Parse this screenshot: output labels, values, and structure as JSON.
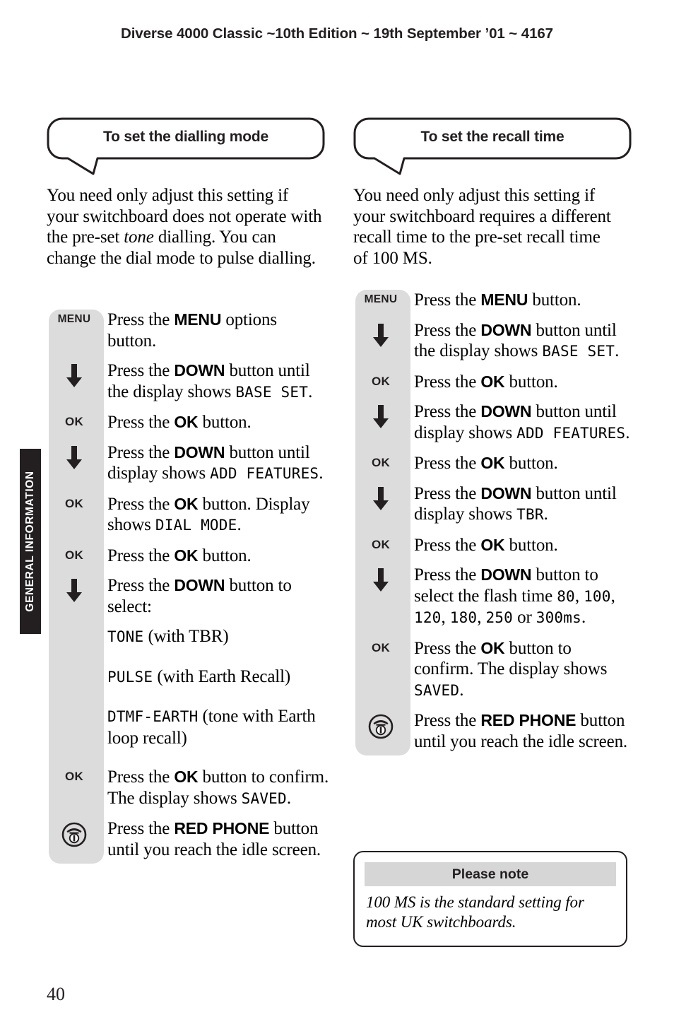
{
  "page": {
    "running_header": "Diverse 4000 Classic ~10th Edition ~ 19th September ’01 ~ 4167",
    "folio": "40",
    "side_tab_label": "GENERAL INFORMATION",
    "colors": {
      "text": "#231f20",
      "rail_grey": "#dcdcdc",
      "note_header_grey": "#d6d6d6",
      "tab_black": "#231f20",
      "page_white": "#ffffff"
    }
  },
  "left_column": {
    "heading": "To set the dialling mode",
    "intro": {
      "part1": "You need only adjust this setting if your switchboard does not operate with the pre-set ",
      "emphasis": "tone",
      "part2": " dialling. You can change the dial mode to pulse dialling."
    },
    "steps": [
      {
        "icon": "menu-button-icon",
        "icon_label": "MENU",
        "text_runs": [
          {
            "style": "normal",
            "text": "Press the "
          },
          {
            "style": "bold",
            "text": "MENU"
          },
          {
            "style": "normal",
            "text": " options button."
          }
        ]
      },
      {
        "icon": "down-arrow-icon",
        "icon_label": "",
        "text_runs": [
          {
            "style": "normal",
            "text": "Press the "
          },
          {
            "style": "bold",
            "text": "DOWN"
          },
          {
            "style": "normal",
            "text": " button until the display shows "
          },
          {
            "style": "lcd",
            "text": "BASE SET"
          },
          {
            "style": "normal",
            "text": "."
          }
        ]
      },
      {
        "icon": "ok-button-icon",
        "icon_label": "OK",
        "text_runs": [
          {
            "style": "normal",
            "text": "Press the "
          },
          {
            "style": "bold",
            "text": "OK"
          },
          {
            "style": "normal",
            "text": " button."
          }
        ]
      },
      {
        "icon": "down-arrow-icon",
        "icon_label": "",
        "text_runs": [
          {
            "style": "normal",
            "text": "Press the "
          },
          {
            "style": "bold",
            "text": "DOWN"
          },
          {
            "style": "normal",
            "text": " button until display shows "
          },
          {
            "style": "lcd",
            "text": "ADD FEATURES"
          },
          {
            "style": "normal",
            "text": "."
          }
        ]
      },
      {
        "icon": "ok-button-icon",
        "icon_label": "OK",
        "text_runs": [
          {
            "style": "normal",
            "text": "Press the "
          },
          {
            "style": "bold",
            "text": "OK"
          },
          {
            "style": "normal",
            "text": " button. Display shows "
          },
          {
            "style": "lcd",
            "text": "DIAL MODE"
          },
          {
            "style": "normal",
            "text": "."
          }
        ]
      },
      {
        "icon": "ok-button-icon",
        "icon_label": "OK",
        "text_runs": [
          {
            "style": "normal",
            "text": "Press the "
          },
          {
            "style": "bold",
            "text": "OK"
          },
          {
            "style": "normal",
            "text": " button."
          }
        ]
      },
      {
        "icon": "down-arrow-icon",
        "icon_label": "",
        "text_runs": [
          {
            "style": "normal",
            "text": "Press the "
          },
          {
            "style": "bold",
            "text": "DOWN"
          },
          {
            "style": "normal",
            "text": " button to select:"
          }
        ],
        "options": [
          {
            "lcd": "TONE",
            "desc": " (with TBR)"
          },
          {
            "lcd": "PULSE",
            "desc": " (with Earth Recall)"
          },
          {
            "lcd": "DTMF-EARTH",
            "desc": " (tone with Earth loop recall)"
          }
        ]
      },
      {
        "icon": "ok-button-icon",
        "icon_label": "OK",
        "text_runs": [
          {
            "style": "normal",
            "text": "Press the "
          },
          {
            "style": "bold",
            "text": "OK"
          },
          {
            "style": "normal",
            "text": " button to confirm. The display shows "
          },
          {
            "style": "lcd",
            "text": "SAVED"
          },
          {
            "style": "normal",
            "text": "."
          }
        ]
      },
      {
        "icon": "red-phone-button-icon",
        "icon_label": "",
        "text_runs": [
          {
            "style": "normal",
            "text": "Press the "
          },
          {
            "style": "bold",
            "text": "RED PHONE"
          },
          {
            "style": "normal",
            "text": " button until you reach the idle screen."
          }
        ]
      }
    ]
  },
  "right_column": {
    "heading": "To set the recall time",
    "intro": {
      "part1": "You need only adjust this setting if your switchboard requires a different recall time to the pre-set recall time of 100 MS.",
      "emphasis": "",
      "part2": ""
    },
    "steps": [
      {
        "icon": "menu-button-icon",
        "icon_label": "MENU",
        "text_runs": [
          {
            "style": "normal",
            "text": "Press the "
          },
          {
            "style": "bold",
            "text": "MENU"
          },
          {
            "style": "normal",
            "text": " button."
          }
        ]
      },
      {
        "icon": "down-arrow-icon",
        "icon_label": "",
        "text_runs": [
          {
            "style": "normal",
            "text": "Press the "
          },
          {
            "style": "bold",
            "text": "DOWN"
          },
          {
            "style": "normal",
            "text": " button until the display shows "
          },
          {
            "style": "lcd",
            "text": "BASE SET"
          },
          {
            "style": "normal",
            "text": "."
          }
        ]
      },
      {
        "icon": "ok-button-icon",
        "icon_label": "OK",
        "text_runs": [
          {
            "style": "normal",
            "text": "Press the "
          },
          {
            "style": "bold",
            "text": "OK"
          },
          {
            "style": "normal",
            "text": " button."
          }
        ]
      },
      {
        "icon": "down-arrow-icon",
        "icon_label": "",
        "text_runs": [
          {
            "style": "normal",
            "text": "Press the "
          },
          {
            "style": "bold",
            "text": "DOWN"
          },
          {
            "style": "normal",
            "text": " button until display shows "
          },
          {
            "style": "lcd",
            "text": "ADD FEATURES"
          },
          {
            "style": "normal",
            "text": "."
          }
        ]
      },
      {
        "icon": "ok-button-icon",
        "icon_label": "OK",
        "text_runs": [
          {
            "style": "normal",
            "text": "Press the "
          },
          {
            "style": "bold",
            "text": "OK"
          },
          {
            "style": "normal",
            "text": " button."
          }
        ]
      },
      {
        "icon": "down-arrow-icon",
        "icon_label": "",
        "text_runs": [
          {
            "style": "normal",
            "text": "Press the "
          },
          {
            "style": "bold",
            "text": "DOWN"
          },
          {
            "style": "normal",
            "text": " button until display shows "
          },
          {
            "style": "lcd",
            "text": "TBR"
          },
          {
            "style": "normal",
            "text": "."
          }
        ]
      },
      {
        "icon": "ok-button-icon",
        "icon_label": "OK",
        "text_runs": [
          {
            "style": "normal",
            "text": "Press the "
          },
          {
            "style": "bold",
            "text": "OK"
          },
          {
            "style": "normal",
            "text": " button."
          }
        ]
      },
      {
        "icon": "down-arrow-icon",
        "icon_label": "",
        "text_runs": [
          {
            "style": "normal",
            "text": "Press the "
          },
          {
            "style": "bold",
            "text": "DOWN"
          },
          {
            "style": "normal",
            "text": " button to select the flash time "
          },
          {
            "style": "lcd",
            "text": "80"
          },
          {
            "style": "normal",
            "text": ", "
          },
          {
            "style": "lcd",
            "text": "100"
          },
          {
            "style": "normal",
            "text": ", "
          },
          {
            "style": "lcd",
            "text": "120"
          },
          {
            "style": "normal",
            "text": ", "
          },
          {
            "style": "lcd",
            "text": "180"
          },
          {
            "style": "normal",
            "text": ", "
          },
          {
            "style": "lcd",
            "text": "250"
          },
          {
            "style": "normal",
            "text": " or "
          },
          {
            "style": "lcd",
            "text": "300ms"
          },
          {
            "style": "normal",
            "text": "."
          }
        ]
      },
      {
        "icon": "ok-button-icon",
        "icon_label": "OK",
        "text_runs": [
          {
            "style": "normal",
            "text": "Press the "
          },
          {
            "style": "bold",
            "text": "OK"
          },
          {
            "style": "normal",
            "text": " button to confirm.  The display shows "
          },
          {
            "style": "lcd",
            "text": "SAVED"
          },
          {
            "style": "normal",
            "text": "."
          }
        ]
      },
      {
        "icon": "red-phone-button-icon",
        "icon_label": "",
        "text_runs": [
          {
            "style": "normal",
            "text": "Press the "
          },
          {
            "style": "bold",
            "text": "RED PHONE"
          },
          {
            "style": "normal",
            "text": " button until you reach the idle screen."
          }
        ]
      }
    ],
    "note": {
      "title": "Please note",
      "body": "100 MS is the standard setting for most UK switchboards."
    }
  }
}
